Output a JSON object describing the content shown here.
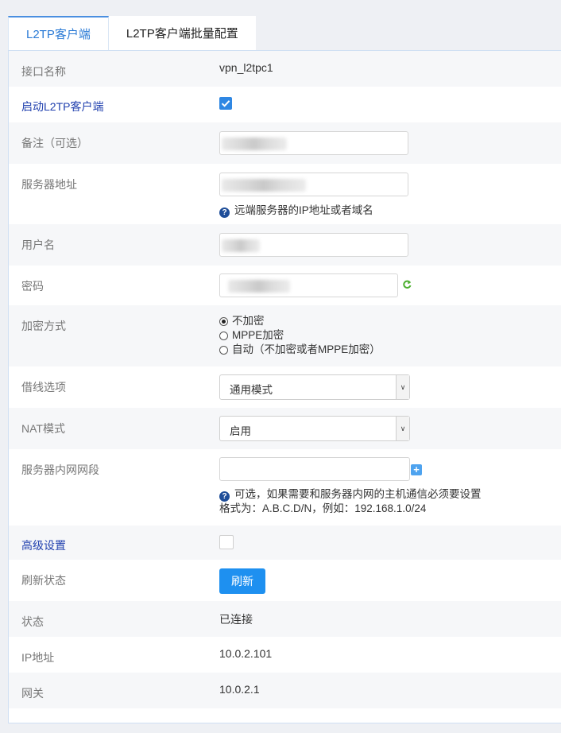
{
  "tabs": [
    {
      "label": "L2TP客户端",
      "active": true
    },
    {
      "label": "L2TP客户端批量配置",
      "active": false
    }
  ],
  "form": {
    "interface_name": {
      "label": "接口名称",
      "value": "vpn_l2tpc1"
    },
    "enable": {
      "label": "启动L2TP客户端",
      "checked": true
    },
    "remark": {
      "label": "备注（可选）",
      "value": ""
    },
    "server_address": {
      "label": "服务器地址",
      "value": "",
      "hint": "远端服务器的IP地址或者域名"
    },
    "username": {
      "label": "用户名",
      "value": ""
    },
    "password": {
      "label": "密码",
      "value": ""
    },
    "encryption": {
      "label": "加密方式",
      "options": [
        "不加密",
        "MPPE加密",
        "自动（不加密或者MPPE加密）"
      ],
      "selected": 0
    },
    "line_borrow": {
      "label": "借线选项",
      "value": "通用模式"
    },
    "nat_mode": {
      "label": "NAT模式",
      "value": "启用"
    },
    "server_subnet": {
      "label": "服务器内网网段",
      "value": "",
      "hint1": "可选，如果需要和服务器内网的主机通信必须要设置",
      "hint2": "格式为：A.B.C.D/N，例如：192.168.1.0/24"
    },
    "advanced": {
      "label": "高级设置",
      "checked": false
    },
    "refresh_status": {
      "label": "刷新状态",
      "button": "刷新"
    },
    "status": {
      "label": "状态",
      "value": "已连接"
    },
    "ip_address": {
      "label": "IP地址",
      "value": "10.0.2.101"
    },
    "gateway": {
      "label": "网关",
      "value": "10.0.2.1"
    }
  },
  "colors": {
    "accent": "#2f87e3",
    "link": "#1f3fae",
    "button": "#1e90f0"
  }
}
